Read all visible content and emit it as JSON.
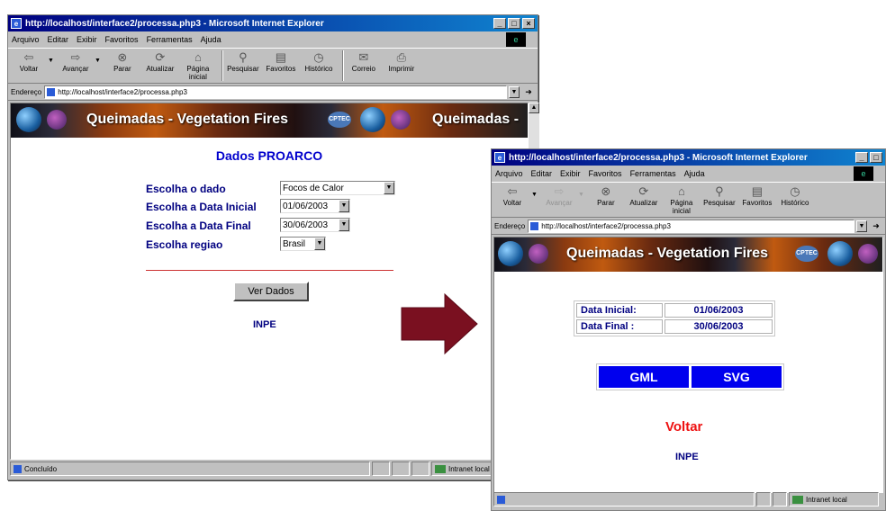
{
  "browser": {
    "menu": [
      "Arquivo",
      "Editar",
      "Exibir",
      "Favoritos",
      "Ferramentas",
      "Ajuda"
    ],
    "toolbar": {
      "back": "Voltar",
      "forward": "Avançar",
      "stop": "Parar",
      "refresh": "Atualizar",
      "home": "Página inicial",
      "search": "Pesquisar",
      "favorites": "Favoritos",
      "history": "Histórico",
      "mail": "Correio",
      "print": "Imprimir"
    },
    "address_label": "Endereço",
    "banner_text": "Queimadas - Vegetation Fires",
    "banner_text_short": "Queimadas -",
    "cptec": "CPTEC",
    "zone": "Intranet local"
  },
  "window1": {
    "title": "http://localhost/interface2/processa.php3 - Microsoft Internet Explorer",
    "address": "http://localhost/interface2/processa.php3",
    "status": "Concluído",
    "page": {
      "heading": "Dados PROARCO",
      "form": {
        "dado": {
          "label": "Escolha o dado",
          "value": "Focos de Calor"
        },
        "data_inicial": {
          "label": "Escolha a Data Inicial",
          "value": "01/06/2003"
        },
        "data_final": {
          "label": "Escolha a Data Final",
          "value": "30/06/2003"
        },
        "regiao": {
          "label": "Escolha regiao",
          "value": "Brasil"
        }
      },
      "submit": "Ver Dados",
      "footer": "INPE"
    }
  },
  "window2": {
    "title": "http://localhost/interface2/processa.php3 - Microsoft Internet Explorer",
    "address": "http://localhost/interface2/processa.php3",
    "page": {
      "dates": [
        {
          "label": "Data Inicial:",
          "value": "01/06/2003"
        },
        {
          "label": "Data Final :",
          "value": "30/06/2003"
        }
      ],
      "formats": [
        "GML",
        "SVG"
      ],
      "back_link": "Voltar",
      "footer": "INPE"
    }
  },
  "colors": {
    "title_blue": "#000080",
    "heading_blue": "#0000cc",
    "format_button": "#0000ee",
    "back_link_red": "#ee1111",
    "separator_red": "#cc3333",
    "arrow_maroon": "#7a1020"
  }
}
